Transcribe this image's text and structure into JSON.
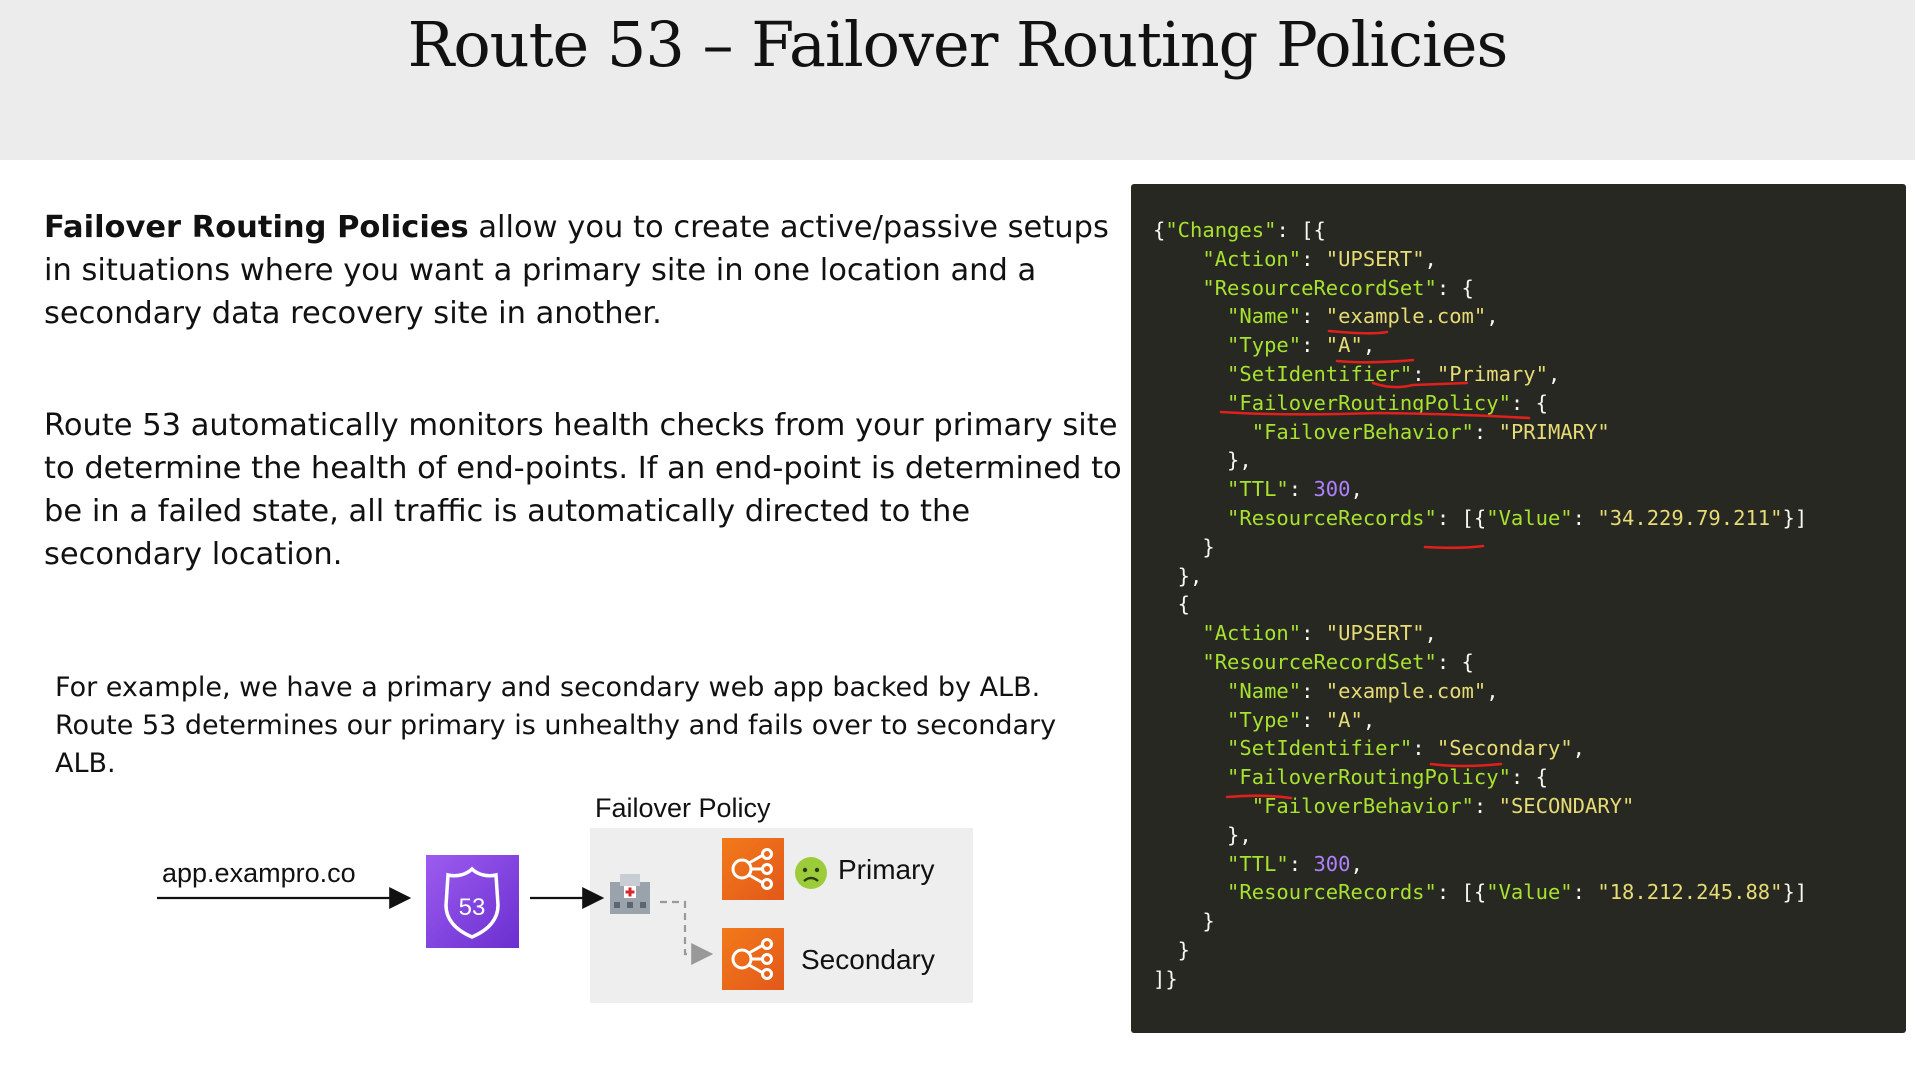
{
  "header": {
    "title": "Route 53 – Failover Routing Policies"
  },
  "intro": {
    "bold": "Failover Routing Policies",
    "rest": " allow you to create active/passive setups in situations where you want a primary site in one location and a secondary data recovery site in another."
  },
  "monitoring_text": "Route 53 automatically monitors health checks from your primary site to determine the health of end-points. If an end-point is determined to be in a failed state, all traffic is automatically directed to the secondary location.",
  "example_text": "For example, we have a primary and secondary web app backed by ALB. Route 53 determines our primary is unhealthy and fails over to secondary ALB.",
  "diagram": {
    "policy_label": "Failover Policy",
    "domain": "app.exampro.co",
    "route53_badge": "53",
    "primary_label": "Primary",
    "secondary_label": "Secondary",
    "icons": [
      "route53-icon",
      "health-check-icon",
      "alb-icon",
      "sick-face-icon"
    ],
    "colors": {
      "route53": "#8c4fe6",
      "alb": "#ed6a1c",
      "policy_box": "#eeeeee"
    }
  },
  "code": {
    "records": [
      {
        "action": "UPSERT",
        "name": "example.com",
        "type": "A",
        "set_identifier": "Primary",
        "failover_behavior": "PRIMARY",
        "ttl": "300",
        "value": "34.229.79.211"
      },
      {
        "action": "UPSERT",
        "name": "example.com",
        "type": "A",
        "set_identifier": "Secondary",
        "failover_behavior": "SECONDARY",
        "ttl": "300",
        "value": "18.212.245.88"
      }
    ],
    "colors": {
      "background": "#272822",
      "key": "#a6e22e",
      "string": "#e6db74",
      "number": "#ae81ff",
      "underline": "#e0201c"
    }
  }
}
